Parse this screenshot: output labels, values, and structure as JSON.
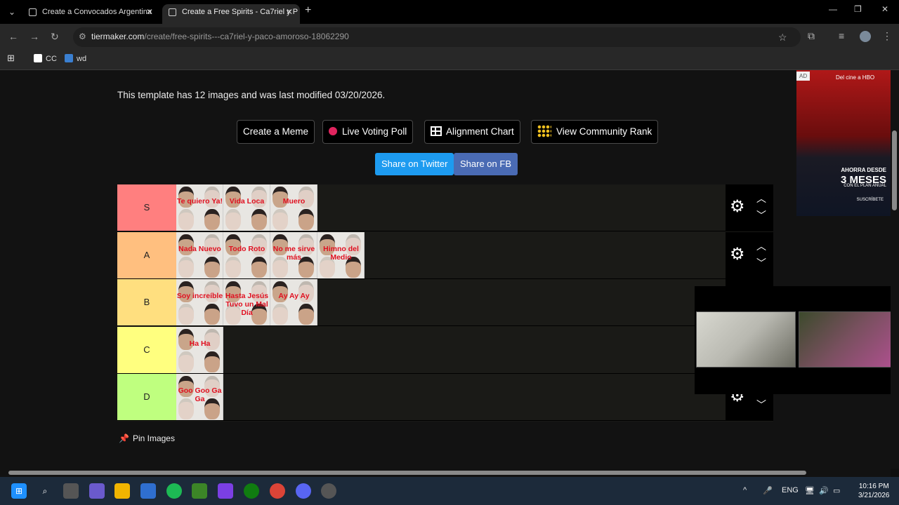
{
  "browser": {
    "tabs": [
      {
        "title": "Create a Convocados Argentina",
        "active": false
      },
      {
        "title": "Create a Free Spirits - Ca7riel y P",
        "active": true
      }
    ],
    "url_domain": "tiermaker.com",
    "url_path": "/create/free-spirits---ca7riel-y-paco-amoroso-18062290",
    "bookmarks": [
      {
        "label": "CC",
        "icon": "wikipedia-icon"
      },
      {
        "label": "wd",
        "icon": "bookmark-icon"
      }
    ]
  },
  "page": {
    "template_info": "This template has 12 images and was last modified 03/20/2026.",
    "buttons": {
      "create_meme": "Create a Meme",
      "live_voting": "Live Voting Poll",
      "alignment": "Alignment Chart",
      "community_rank": "View Community Rank"
    },
    "share": {
      "twitter": "Share on Twitter",
      "facebook": "Share on FB"
    },
    "pin_images": "Pin Images"
  },
  "tiers": [
    {
      "label": "S",
      "color": "#ff7f7f",
      "items": [
        "Te quiero Ya!",
        "Vida Loca",
        "Muero"
      ]
    },
    {
      "label": "A",
      "color": "#ffbf7f",
      "items": [
        "Nada Nuevo",
        "Todo Roto",
        "No me sirve más",
        "Himno del Medio"
      ]
    },
    {
      "label": "B",
      "color": "#ffdf7f",
      "items": [
        "Soy increíble",
        "Hasta Jesús Tuvo un Mal Día",
        "Ay Ay Ay"
      ]
    },
    {
      "label": "C",
      "color": "#ffff7f",
      "items": [
        "Ha Ha"
      ]
    },
    {
      "label": "D",
      "color": "#bfff7f",
      "items": [
        "Goo Goo Ga Ga"
      ]
    }
  ],
  "ad": {
    "tag": "AD",
    "line1": "Del cine a HBO",
    "line2": "AHORRA DESDE",
    "line3": "3 MESES",
    "line4": "CON EL PLAN ANUAL",
    "line5": "SUSCRÍBETE"
  },
  "taskbar": {
    "language": "ENG",
    "time": "10:16 PM",
    "date": "3/21/2026"
  }
}
